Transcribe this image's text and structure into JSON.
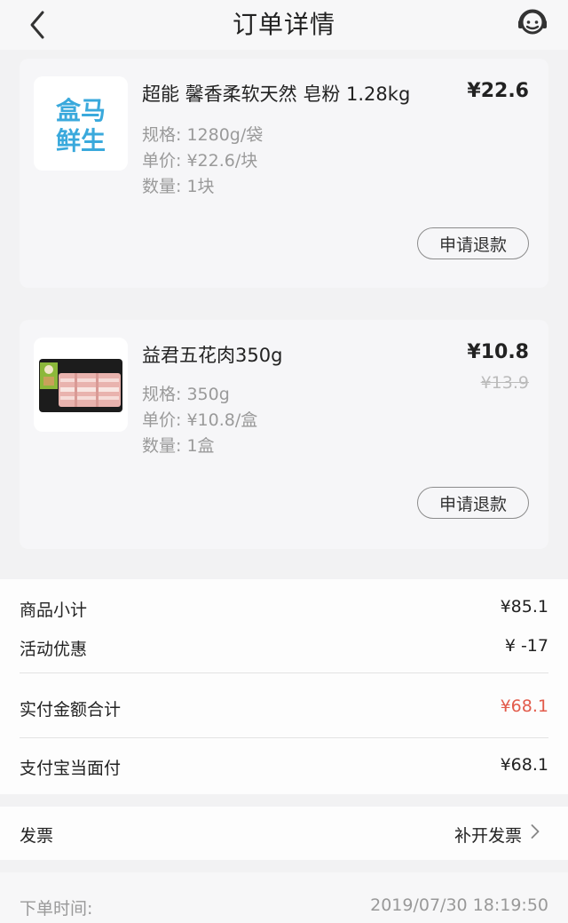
{
  "header": {
    "title": "订单详情"
  },
  "items": [
    {
      "name": "超能 馨香柔软天然 皂粉 1.28kg",
      "price": "¥22.6",
      "spec": "规格: 1280g/袋",
      "unit_price": "单价: ¥22.6/块",
      "quantity": "数量: 1块",
      "refund_label": "申请退款",
      "logo_line1": "盒马",
      "logo_line2": "鲜生"
    },
    {
      "name": "益君五花肉350g",
      "price": "¥10.8",
      "original_price": "¥13.9",
      "spec": "规格: 350g",
      "unit_price": "单价: ¥10.8/盒",
      "quantity": "数量: 1盒",
      "refund_label": "申请退款"
    }
  ],
  "summary": {
    "subtotal_label": "商品小计",
    "subtotal_value": "¥85.1",
    "discount_label": "活动优惠",
    "discount_value": "¥ -17",
    "paid_label": "实付金额合计",
    "paid_value": "¥68.1",
    "paid_color": "#e25b4b",
    "method_label": "支付宝当面付",
    "method_value": "¥68.1"
  },
  "invoice": {
    "label": "发票",
    "action": "补开发票"
  },
  "order_time": {
    "label": "下单时间:",
    "value": "2019/07/30 18:19:50"
  },
  "icons": {
    "back": "chevron-left-icon",
    "service": "customer-service-icon",
    "arrow": "chevron-right-icon"
  }
}
